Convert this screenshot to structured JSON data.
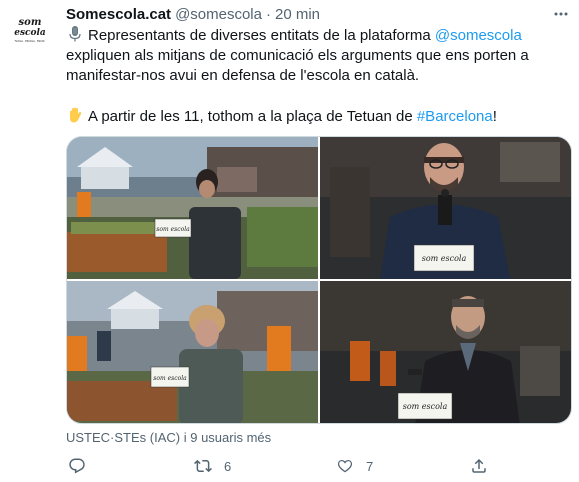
{
  "tweet": {
    "display_name": "Somescola.cat",
    "handle": "@somescola",
    "separator": "·",
    "time": "20 min",
    "avatar_text_top": "som",
    "avatar_text_bottom": "escola",
    "avatar_caption": "ESCOLA · ESCOLA · ESCOLA",
    "line1_pre": "Representants de diverses entitats de la plataforma",
    "line1_link": "@somescola",
    "line2": "expliquen als mitjans de comunicació els arguments que ens porten a",
    "line3": "manifestar-nos avui en defensa de l'escola en català.",
    "line4_pre": "A partir de les 11, tothom a la plaça de Tetuan de",
    "line4_link": "#Barcelona",
    "line4_post": "!",
    "emoji_1": "microphone-icon",
    "emoji_2": "raised-hand-icon",
    "sign_label": "som escola",
    "tagged": "USTEC·STEs (IAC) i 9 usuaris més",
    "retweets": "6",
    "likes": "7",
    "colors": {
      "link": "#1d9bf0",
      "secondary": "#536471",
      "border": "#cfd9de"
    }
  }
}
